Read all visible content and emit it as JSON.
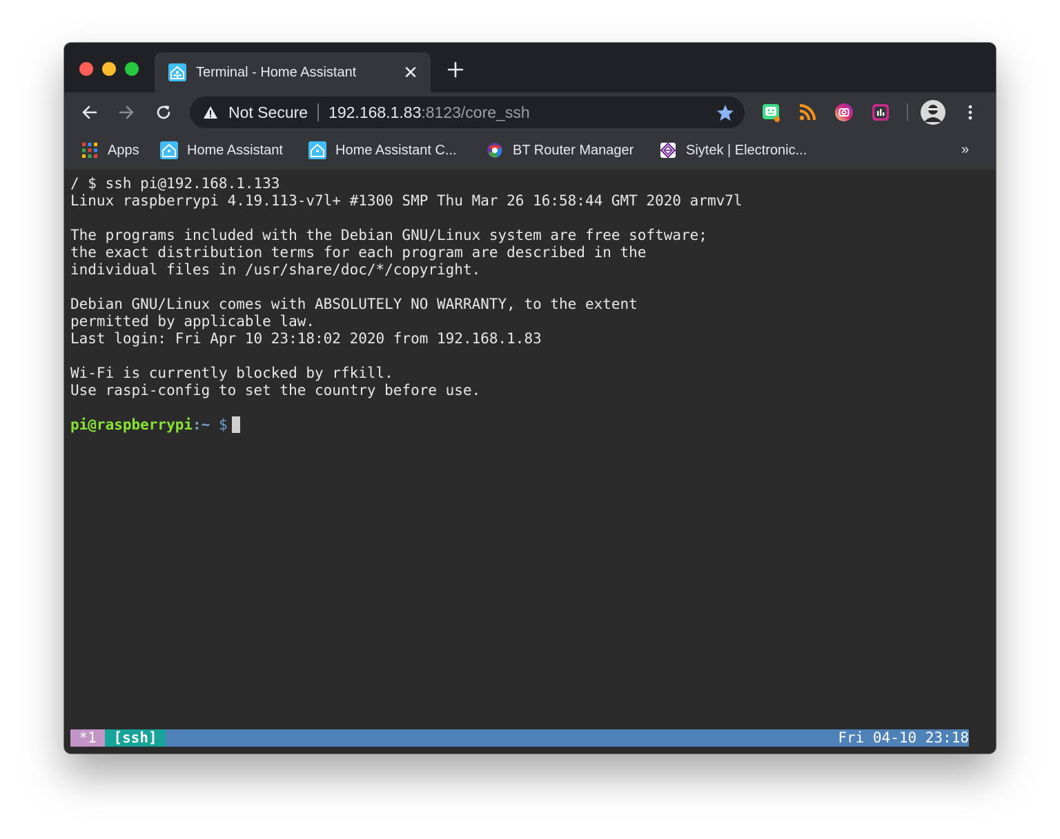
{
  "tab": {
    "title": "Terminal - Home Assistant",
    "close_glyph": "✕",
    "favicon": "home-assistant-icon"
  },
  "toolbar": {
    "security_label": "Not Secure",
    "url_host": "192.168.1.83",
    "url_rest": ":8123/core_ssh",
    "extensions": [
      "chat-extension-icon",
      "rss-extension-icon",
      "camera-extension-icon",
      "analytics-extension-icon"
    ]
  },
  "bookmarks": {
    "items": [
      {
        "label": "Apps",
        "icon": "apps-grid-icon"
      },
      {
        "label": "Home Assistant",
        "icon": "home-assistant-icon"
      },
      {
        "label": "Home Assistant C...",
        "icon": "home-assistant-icon"
      },
      {
        "label": "BT Router Manager",
        "icon": "bt-globe-icon"
      },
      {
        "label": "Siytek | Electronic...",
        "icon": "siytek-logo-icon"
      }
    ],
    "more": "»"
  },
  "terminal": {
    "lines": [
      "/ $ ssh pi@192.168.1.133",
      "Linux raspberrypi 4.19.113-v7l+ #1300 SMP Thu Mar 26 16:58:44 GMT 2020 armv7l",
      "",
      "The programs included with the Debian GNU/Linux system are free software;",
      "the exact distribution terms for each program are described in the",
      "individual files in /usr/share/doc/*/copyright.",
      "",
      "Debian GNU/Linux comes with ABSOLUTELY NO WARRANTY, to the extent",
      "permitted by applicable law.",
      "Last login: Fri Apr 10 23:18:02 2020 from 192.168.1.83",
      "",
      "Wi-Fi is currently blocked by rfkill.",
      "Use raspi-config to set the country before use.",
      ""
    ],
    "prompt": {
      "user_host": "pi@raspberrypi",
      "path": ":~",
      "symbol": " $"
    }
  },
  "statusbar": {
    "window": "*1",
    "session": "[ssh]",
    "clock": "Fri 04-10 23:18"
  },
  "colors": {
    "prompt_user": "#8ae234",
    "statusbar_bg": "#4e81b7",
    "session_bg": "#17a39a",
    "window_bg": "#c394c6"
  }
}
